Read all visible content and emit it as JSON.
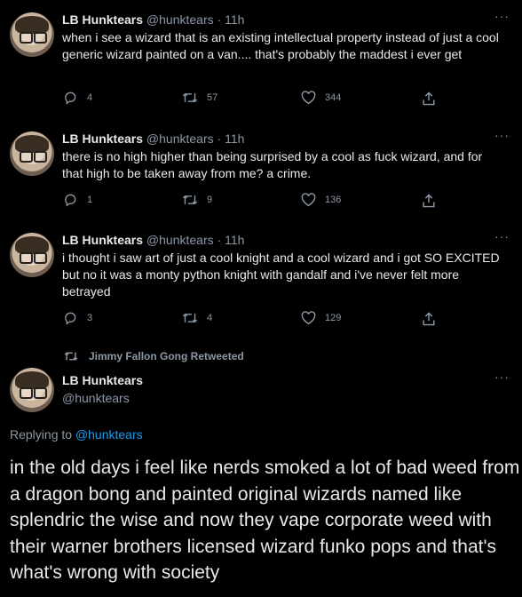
{
  "tweets": [
    {
      "name": "LB Hunktears",
      "handle": "@hunktears",
      "time": "· 11h",
      "text": "when i see a wizard that is an existing intellectual property instead of just a cool generic wizard painted on a van.... that's probably the maddest i ever get",
      "replies": "4",
      "retweets": "57",
      "likes": "344"
    },
    {
      "name": "LB Hunktears",
      "handle": "@hunktears",
      "time": "· 11h",
      "text": "there is no high higher than being surprised by a cool as fuck wizard, and for that high to be taken away from me? a crime.",
      "replies": "1",
      "retweets": "9",
      "likes": "136"
    },
    {
      "name": "LB Hunktears",
      "handle": "@hunktears",
      "time": "· 11h",
      "text": "i thought i saw art of just a cool knight and a cool wizard and i got SO EXCITED but no it was a monty python knight with gandalf and i've never felt more betrayed",
      "replies": "3",
      "retweets": "4",
      "likes": "129"
    }
  ],
  "retweeted_by": "Jimmy Fallon Gong Retweeted",
  "main_tweet": {
    "name": "LB Hunktears",
    "handle": "@hunktears",
    "replying_prefix": "Replying to",
    "replying_to": "@hunktears",
    "text": "in the old days i feel like nerds smoked a lot of bad weed from a dragon bong and painted original wizards named like splendric the wise and now they vape corporate weed with their warner brothers licensed wizard funko pops and that's what's wrong with society"
  },
  "more_label": "···",
  "icons": [
    "reply-icon",
    "retweet-icon",
    "like-icon",
    "share-icon",
    "more-icon",
    "retweet-small-icon"
  ],
  "colors": {
    "background": "#000000",
    "text": "#e7e9ea",
    "muted": "#8b98a5",
    "link": "#1d9bf0"
  }
}
